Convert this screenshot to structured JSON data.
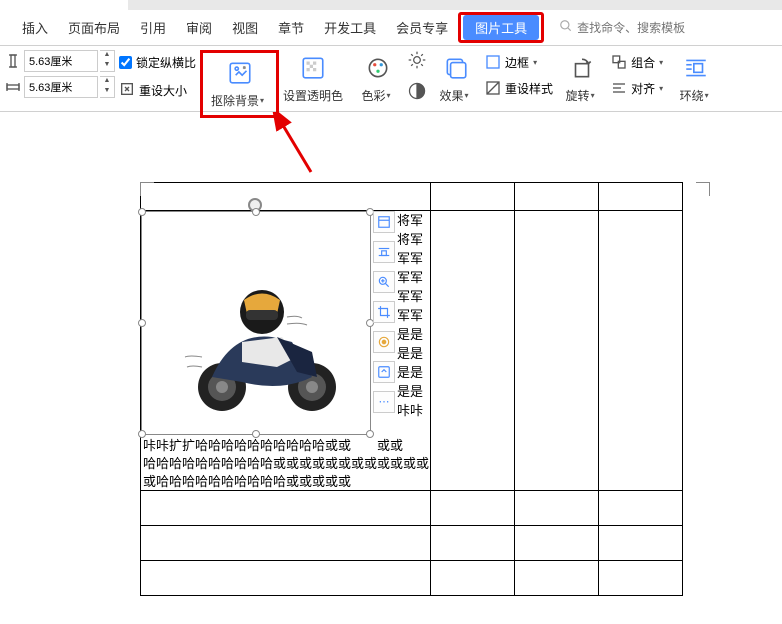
{
  "tabs": {
    "insert": "插入",
    "page_layout": "页面布局",
    "reference": "引用",
    "review": "审阅",
    "view": "视图",
    "chapter": "章节",
    "dev_tools": "开发工具",
    "member": "会员专享",
    "picture_tools": "图片工具"
  },
  "search": {
    "placeholder": "查找命令、搜索模板"
  },
  "ribbon": {
    "height_value": "5.63厘米",
    "width_value": "5.63厘米",
    "lock_ratio": "锁定纵横比",
    "reset_size": "重设大小",
    "remove_bg": "抠除背景",
    "set_transparent": "设置透明色",
    "color": "色彩",
    "effect": "效果",
    "reset_style": "重设样式",
    "border": "边框",
    "rotate": "旋转",
    "group": "组合",
    "align": "对齐",
    "wrap": "环绕"
  },
  "doc": {
    "row0": "将军将军",
    "row1": "军军",
    "row2": "军军军军",
    "row3": "军军",
    "row4": "是是",
    "row5": "是是",
    "row6": "是是",
    "row7": "是是",
    "row8": "",
    "row9": "咔咔",
    "line1": "咔咔扩扩哈哈哈哈哈哈哈哈哈哈或或",
    "line1b": "或或",
    "line2": "哈哈哈哈哈哈哈哈哈哈或或或或或或或或或或或或",
    "line3": "或哈哈哈哈哈哈哈哈哈哈或或或或或"
  }
}
